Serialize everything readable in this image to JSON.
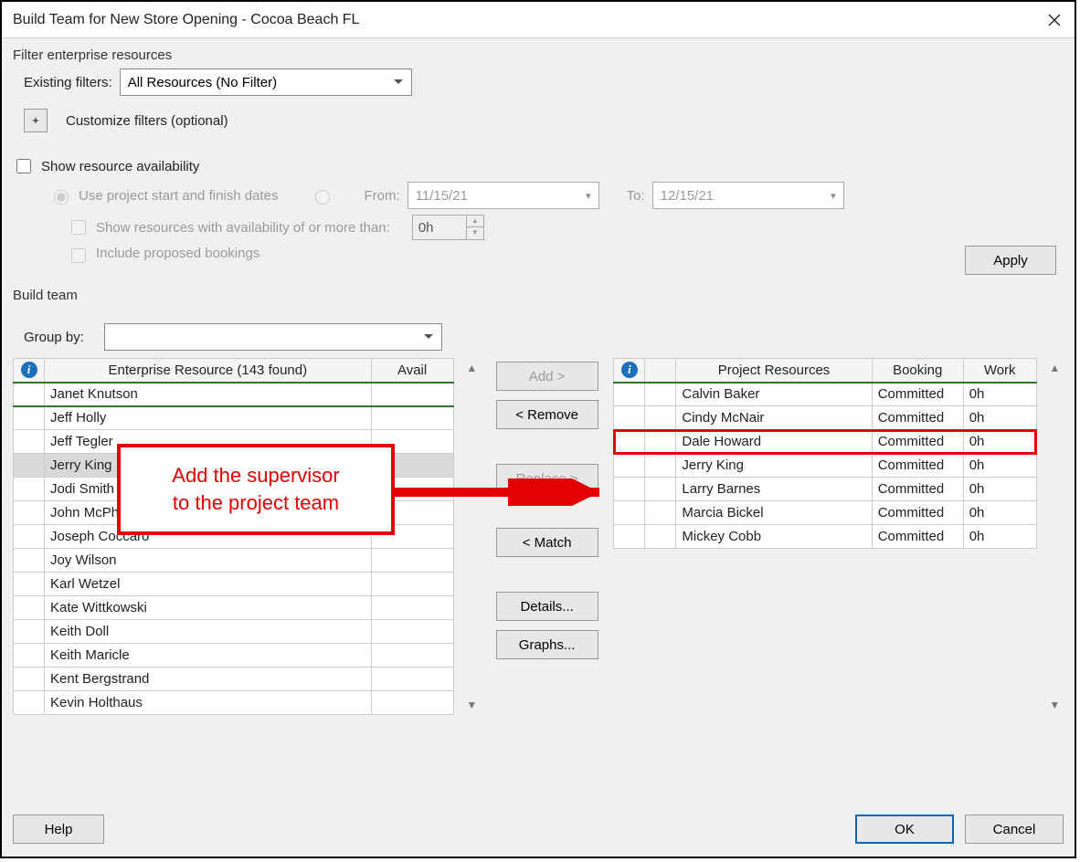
{
  "window": {
    "title": "Build Team for New Store Opening - Cocoa Beach FL"
  },
  "filter_section": {
    "legend": "Filter enterprise resources",
    "existing_label": "Existing filters:",
    "existing_value": "All Resources (No Filter)",
    "customize_label": "Customize filters (optional)",
    "plus": "+"
  },
  "availability": {
    "show_label": "Show resource availability",
    "use_dates_label": "Use project start and finish dates",
    "from_label": "From:",
    "from_value": "11/15/21",
    "to_label": "To:",
    "to_value": "12/15/21",
    "avail_of_label": "Show resources with availability of or more than:",
    "avail_value": "0h",
    "include_proposed_label": "Include proposed bookings",
    "apply_label": "Apply"
  },
  "build_team": {
    "legend": "Build team",
    "group_by_label": "Group by:",
    "group_by_value": ""
  },
  "left_grid": {
    "header_resource": "Enterprise Resource (143 found)",
    "header_avail": "Avail",
    "rows": [
      "Janet Knutson",
      "Jeff Holly",
      "Jeff Tegler",
      "Jerry King",
      "Jodi Smith",
      "John McPherson",
      "Joseph Coccaro",
      "Joy Wilson",
      "Karl Wetzel",
      "Kate Wittkowski",
      "Keith Doll",
      "Keith Maricle",
      "Kent Bergstrand",
      "Kevin Holthaus"
    ],
    "selected_index": 3
  },
  "mid_buttons": {
    "add": "Add >",
    "remove": "< Remove",
    "replace": "Replace >",
    "match": "< Match",
    "details": "Details...",
    "graphs": "Graphs..."
  },
  "right_grid": {
    "header_resources": "Project Resources",
    "header_booking": "Booking",
    "header_work": "Work",
    "rows": [
      {
        "name": "Calvin Baker",
        "booking": "Committed",
        "work": "0h"
      },
      {
        "name": "Cindy McNair",
        "booking": "Committed",
        "work": "0h"
      },
      {
        "name": "Dale Howard",
        "booking": "Committed",
        "work": "0h"
      },
      {
        "name": "Jerry King",
        "booking": "Committed",
        "work": "0h"
      },
      {
        "name": "Larry Barnes",
        "booking": "Committed",
        "work": "0h"
      },
      {
        "name": "Marcia Bickel",
        "booking": "Committed",
        "work": "0h"
      },
      {
        "name": "Mickey Cobb",
        "booking": "Committed",
        "work": "0h"
      }
    ],
    "highlight_index": 2
  },
  "callout": {
    "line1": "Add the supervisor",
    "line2": "to the project team"
  },
  "bottom": {
    "help": "Help",
    "ok": "OK",
    "cancel": "Cancel"
  }
}
